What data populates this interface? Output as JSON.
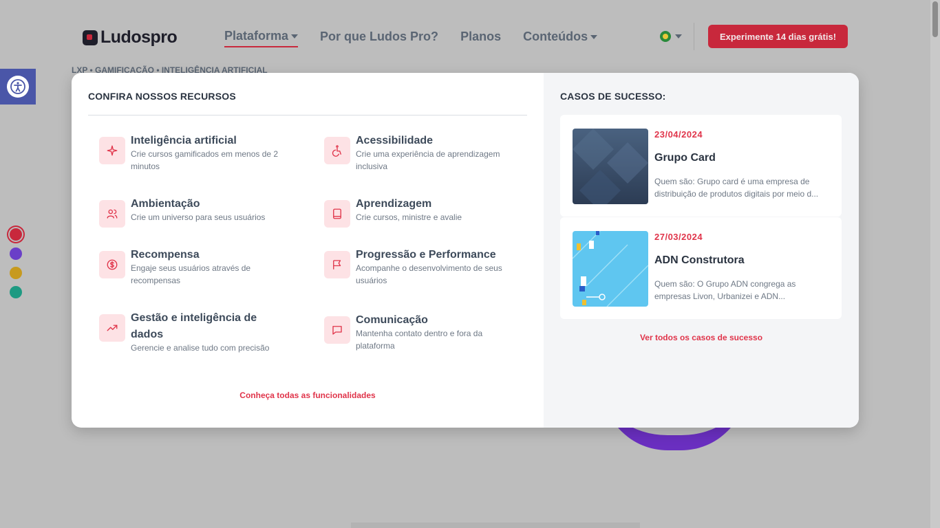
{
  "header": {
    "logo_text": "Ludospro",
    "nav": [
      {
        "label": "Plataforma",
        "has_caret": true
      },
      {
        "label": "Por que Ludos Pro?",
        "has_caret": false
      },
      {
        "label": "Planos",
        "has_caret": false
      },
      {
        "label": "Conteúdos",
        "has_caret": true
      }
    ],
    "cta_label": "Experimente 14 dias grátis!",
    "tagline": "LXP • GAMIFICAÇÃO • INTELIGÊNCIA ARTIFICIAL"
  },
  "resources": {
    "title": "CONFIRA NOSSOS RECURSOS",
    "items": [
      {
        "icon": "sparkles-icon",
        "title": "Inteligência artificial",
        "desc": "Crie cursos gamificados em menos de 2 minutos"
      },
      {
        "icon": "wheelchair-icon",
        "title": "Acessibilidade",
        "desc": "Crie uma experiência de aprendizagem inclusiva"
      },
      {
        "icon": "users-icon",
        "title": "Ambientação",
        "desc": "Crie um universo para seus usuários"
      },
      {
        "icon": "book-icon",
        "title": "Aprendizagem",
        "desc": "Crie cursos, ministre e avalie"
      },
      {
        "icon": "dollar-icon",
        "title": "Recompensa",
        "desc": "Engaje seus usuários através de recompensas"
      },
      {
        "icon": "flag-icon",
        "title": "Progressão e Performance",
        "desc": "Acompanhe o desenvolvimento de seus usuários"
      },
      {
        "icon": "trending-up-icon",
        "title": "Gestão e inteligência de dados",
        "desc": "Gerencie e analise tudo com precisão"
      },
      {
        "icon": "message-icon",
        "title": "Comunicação",
        "desc": "Mantenha contato dentro e fora da plataforma"
      }
    ],
    "all_link": "Conheça todas as funcionalidades"
  },
  "cases": {
    "title": "CASOS DE SUCESSO:",
    "items": [
      {
        "date": "23/04/2024",
        "name": "Grupo Card",
        "desc": "Quem são:   Grupo card é uma empresa de distribuição de produtos digitais por meio d..."
      },
      {
        "date": "27/03/2024",
        "name": "ADN Construtora",
        "desc": "Quem são:   O Grupo ADN congrega as empresas Livon, Urbanizei e ADN..."
      }
    ],
    "all_link": "Ver todos os casos de sucesso"
  },
  "colors": {
    "brand_red": "#c8283c",
    "link_red": "#e0344a",
    "theme_dots": [
      "#c8283c",
      "#6a3fc8",
      "#c79a1e",
      "#1e9a82"
    ]
  }
}
